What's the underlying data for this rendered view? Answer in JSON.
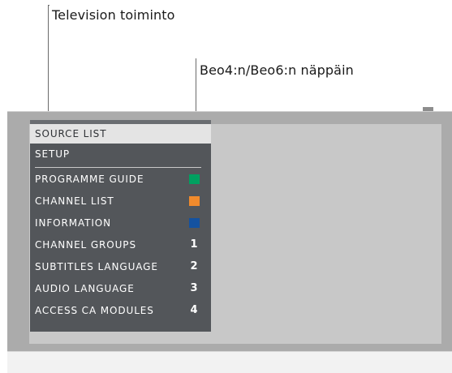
{
  "callouts": {
    "television_function": "Television toiminto",
    "remote_key": "Beo4:n/Beo6:n näppäin"
  },
  "menu": {
    "items": [
      {
        "label": "SOURCE LIST",
        "highlighted": true
      },
      {
        "label": "SETUP"
      },
      {
        "label": "PROGRAMME GUIDE",
        "key_color": "#00a060",
        "key_icon": "green-key-icon"
      },
      {
        "label": "CHANNEL LIST",
        "key_color": "#f08a2c",
        "key_icon": "yellow-key-icon"
      },
      {
        "label": "INFORMATION",
        "key_color": "#1452a0",
        "key_icon": "blue-key-icon"
      },
      {
        "label": "CHANNEL GROUPS",
        "key_number": "1"
      },
      {
        "label": "SUBTITLES LANGUAGE",
        "key_number": "2"
      },
      {
        "label": "AUDIO LANGUAGE",
        "key_number": "3"
      },
      {
        "label": "ACCESS CA MODULES",
        "key_number": "4"
      }
    ]
  },
  "colors": {
    "menu_background": "#53565a",
    "highlight": "#e4e4e4",
    "tv_frame": "#ababab",
    "tv_screen": "#c8c8c8"
  }
}
